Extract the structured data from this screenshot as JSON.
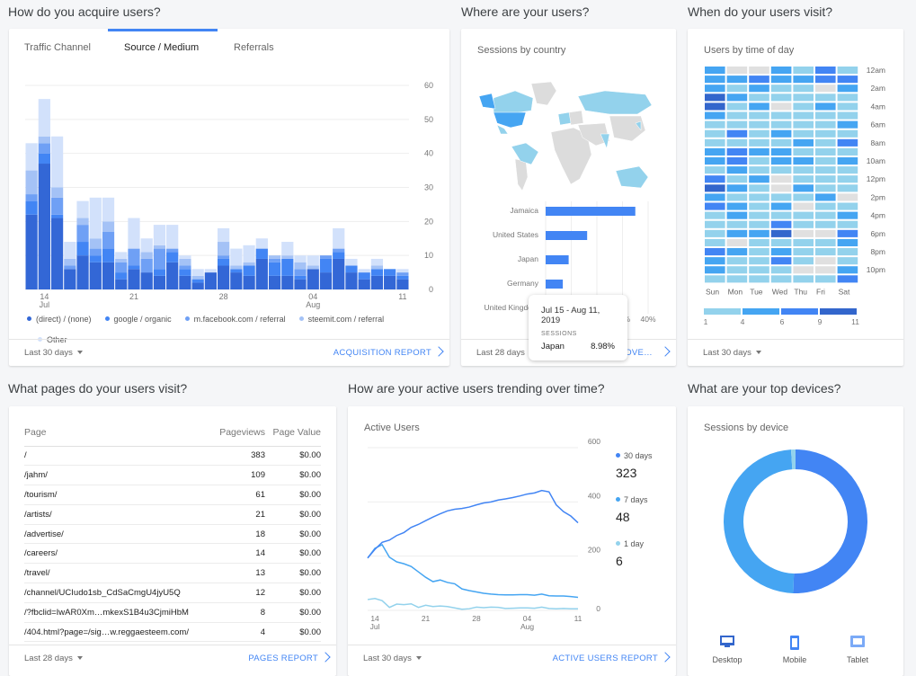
{
  "acquisition": {
    "section_title": "How do you acquire users?",
    "tabs": [
      {
        "label": "Traffic Channel",
        "active": false
      },
      {
        "label": "Source / Medium",
        "active": true
      },
      {
        "label": "Referrals",
        "active": false
      }
    ],
    "date_range": "Last 30 days",
    "report_link": "ACQUISITION REPORT"
  },
  "location": {
    "section_title": "Where are your users?",
    "card_title": "Sessions by country",
    "date_range": "Last 28 days",
    "report_link": "LOCATION OVERVIEW",
    "tooltip": {
      "date": "Jul 15 - Aug 11, 2019",
      "metric": "SESSIONS",
      "country": "Japan",
      "value": "8.98%"
    }
  },
  "time_of_day": {
    "section_title": "When do your users visit?",
    "card_title": "Users by time of day",
    "date_range": "Last 30 days"
  },
  "pages": {
    "section_title": "What pages do your users visit?",
    "columns": [
      "Page",
      "Pageviews",
      "Page Value"
    ],
    "rows": [
      [
        "/",
        "383",
        "$0.00"
      ],
      [
        "/jahm/",
        "109",
        "$0.00"
      ],
      [
        "/tourism/",
        "61",
        "$0.00"
      ],
      [
        "/artists/",
        "21",
        "$0.00"
      ],
      [
        "/advertise/",
        "18",
        "$0.00"
      ],
      [
        "/careers/",
        "14",
        "$0.00"
      ],
      [
        "/travel/",
        "13",
        "$0.00"
      ],
      [
        "/channel/UCIudo1sb_CdSaCmgU4jyU5Q",
        "12",
        "$0.00"
      ],
      [
        "/?fbclid=IwAR0Xm…mkexS1B4u3CjmiHbM",
        "8",
        "$0.00"
      ],
      [
        "/404.html?page=/sig…w.reggaesteem.com/",
        "4",
        "$0.00"
      ]
    ],
    "date_range": "Last 28 days",
    "report_link": "PAGES REPORT"
  },
  "active_users": {
    "section_title": "How are your active users trending over time?",
    "card_title": "Active Users",
    "legend": [
      {
        "label": "30 days",
        "value": "323",
        "color": "#4285f4"
      },
      {
        "label": "7 days",
        "value": "48",
        "color": "#45a5f2"
      },
      {
        "label": "1 day",
        "value": "6",
        "color": "#93d2ec"
      }
    ],
    "date_range": "Last 30 days",
    "report_link": "ACTIVE USERS REPORT"
  },
  "devices": {
    "section_title": "What are your top devices?",
    "card_title": "Sessions by device",
    "legend": [
      {
        "label": "Desktop",
        "icon": "desktop-icon",
        "color": "#3366cc"
      },
      {
        "label": "Mobile",
        "icon": "mobile-icon",
        "color": "#4285f4"
      },
      {
        "label": "Tablet",
        "icon": "tablet-icon",
        "color": "#7baaf7"
      }
    ]
  },
  "chart_data": [
    {
      "type": "bar",
      "stacked": true,
      "x_ticks": [
        {
          "label": "14",
          "sub": "Jul",
          "index": 1
        },
        {
          "label": "21",
          "index": 8
        },
        {
          "label": "28",
          "index": 15
        },
        {
          "label": "04",
          "sub": "Aug",
          "index": 22
        },
        {
          "label": "11",
          "index": 29
        }
      ],
      "categories": [
        "Jul 13",
        "Jul 14",
        "Jul 15",
        "Jul 16",
        "Jul 17",
        "Jul 18",
        "Jul 19",
        "Jul 20",
        "Jul 21",
        "Jul 22",
        "Jul 23",
        "Jul 24",
        "Jul 25",
        "Jul 26",
        "Jul 27",
        "Jul 28",
        "Jul 29",
        "Jul 30",
        "Jul 31",
        "Aug 1",
        "Aug 2",
        "Aug 3",
        "Aug 4",
        "Aug 5",
        "Aug 6",
        "Aug 7",
        "Aug 8",
        "Aug 9",
        "Aug 10",
        "Aug 11"
      ],
      "ylim": [
        0,
        60
      ],
      "yticks": [
        0,
        10,
        20,
        30,
        40,
        50,
        60
      ],
      "grid": true,
      "legend": "bottom",
      "series": [
        {
          "name": "(direct) / (none)",
          "color": "#3367d6",
          "values": [
            22,
            37,
            21,
            6,
            10,
            8,
            8,
            3,
            6,
            5,
            4,
            8,
            4,
            2,
            5,
            7,
            5,
            4,
            9,
            4,
            4,
            3,
            6,
            5,
            9,
            5,
            3,
            4,
            4,
            3
          ]
        },
        {
          "name": "google / organic",
          "color": "#4285f4",
          "values": [
            4,
            3,
            1,
            0,
            4,
            2,
            4,
            2,
            1,
            0,
            2,
            3,
            2,
            1,
            0,
            2,
            1,
            3,
            3,
            4,
            5,
            1,
            0,
            4,
            2,
            2,
            2,
            2,
            2,
            1
          ]
        },
        {
          "name": "m.facebook.com / referral",
          "color": "#6fa0f5",
          "values": [
            2,
            3,
            5,
            1,
            5,
            2,
            5,
            3,
            5,
            4,
            6,
            1,
            1,
            0,
            0,
            1,
            0,
            0,
            0,
            1,
            0,
            2,
            0,
            1,
            1,
            0,
            0,
            0,
            0,
            1
          ]
        },
        {
          "name": "steemit.com / referral",
          "color": "#a4c2f6",
          "values": [
            7,
            2,
            3,
            2,
            2,
            3,
            3,
            1,
            0,
            2,
            1,
            0,
            2,
            1,
            0,
            4,
            1,
            1,
            0,
            1,
            1,
            2,
            1,
            0,
            0,
            0,
            0,
            1,
            0,
            0
          ]
        },
        {
          "name": "Other",
          "color": "#d2e1fb",
          "values": [
            8,
            11,
            15,
            5,
            5,
            12,
            7,
            2,
            9,
            4,
            6,
            7,
            1,
            2,
            1,
            4,
            5,
            5,
            3,
            0,
            4,
            2,
            3,
            0,
            6,
            2,
            1,
            2,
            0,
            1
          ]
        }
      ]
    },
    {
      "type": "bar",
      "orientation": "horizontal",
      "categories": [
        "Jamaica",
        "United States",
        "Japan",
        "Germany",
        "United Kingdom"
      ],
      "values": [
        35,
        16.2,
        8.98,
        6.7,
        null
      ],
      "xlim": [
        0,
        40
      ],
      "xticks": [
        "0%",
        "10%",
        "20%",
        "30%",
        "40%"
      ],
      "color": "#4285f4"
    },
    {
      "type": "heatmap",
      "rows": [
        "12am",
        "1am",
        "2am",
        "3am",
        "4am",
        "5am",
        "6am",
        "7am",
        "8am",
        "9am",
        "10am",
        "11am",
        "12pm",
        "1pm",
        "2pm",
        "3pm",
        "4pm",
        "5pm",
        "6pm",
        "7pm",
        "8pm",
        "9pm",
        "10pm",
        "11pm"
      ],
      "row_labels": [
        "12am",
        "2am",
        "4am",
        "6am",
        "8am",
        "10am",
        "12pm",
        "2pm",
        "4pm",
        "6pm",
        "8pm",
        "10pm"
      ],
      "columns": [
        "Sun",
        "Mon",
        "Tue",
        "Wed",
        "Thu",
        "Fri",
        "Sat"
      ],
      "scale_labels": [
        "1",
        "4",
        "6",
        "9",
        "11"
      ],
      "colors": [
        "#e0e0e0",
        "#93d2ec",
        "#45a5f2",
        "#4285f4",
        "#3366cc"
      ],
      "levels": [
        [
          2,
          0,
          0,
          2,
          1,
          3,
          1
        ],
        [
          2,
          2,
          3,
          2,
          2,
          3,
          3
        ],
        [
          2,
          1,
          2,
          1,
          1,
          0,
          2
        ],
        [
          4,
          2,
          1,
          1,
          1,
          1,
          1
        ],
        [
          4,
          1,
          2,
          0,
          1,
          2,
          1
        ],
        [
          2,
          1,
          1,
          1,
          1,
          1,
          1
        ],
        [
          1,
          1,
          1,
          1,
          1,
          1,
          2
        ],
        [
          1,
          3,
          1,
          2,
          1,
          1,
          1
        ],
        [
          1,
          1,
          1,
          1,
          2,
          1,
          3
        ],
        [
          2,
          3,
          2,
          2,
          1,
          1,
          1
        ],
        [
          2,
          3,
          1,
          2,
          2,
          1,
          2
        ],
        [
          1,
          2,
          1,
          1,
          1,
          1,
          1
        ],
        [
          3,
          1,
          2,
          0,
          1,
          1,
          1
        ],
        [
          4,
          2,
          1,
          0,
          2,
          1,
          1
        ],
        [
          2,
          1,
          1,
          1,
          1,
          2,
          0
        ],
        [
          3,
          2,
          1,
          2,
          0,
          1,
          1
        ],
        [
          1,
          2,
          1,
          1,
          1,
          1,
          2
        ],
        [
          1,
          1,
          1,
          3,
          1,
          1,
          1
        ],
        [
          1,
          2,
          2,
          4,
          0,
          0,
          3
        ],
        [
          1,
          0,
          1,
          1,
          1,
          1,
          2
        ],
        [
          3,
          2,
          1,
          2,
          1,
          1,
          1
        ],
        [
          2,
          1,
          1,
          3,
          1,
          0,
          1
        ],
        [
          2,
          1,
          1,
          1,
          0,
          0,
          2
        ],
        [
          1,
          1,
          1,
          1,
          1,
          1,
          3
        ]
      ]
    },
    {
      "type": "line",
      "ylim": [
        0,
        600
      ],
      "yticks": [
        0,
        200,
        400,
        600
      ],
      "grid": true,
      "legend": "right",
      "x_ticks": [
        {
          "label": "14",
          "sub": "Jul",
          "index": 1
        },
        {
          "label": "21",
          "index": 8
        },
        {
          "label": "28",
          "index": 15
        },
        {
          "label": "04",
          "sub": "Aug",
          "index": 22
        },
        {
          "label": "11",
          "index": 29
        }
      ],
      "series": [
        {
          "name": "30 days",
          "color": "#4285f4",
          "values": [
            193,
            225,
            251,
            259,
            276,
            287,
            306,
            317,
            331,
            344,
            356,
            367,
            373,
            376,
            381,
            389,
            396,
            400,
            407,
            411,
            416,
            422,
            429,
            433,
            442,
            437,
            389,
            364,
            348,
            323
          ]
        },
        {
          "name": "7 days",
          "color": "#45a5f2",
          "values": [
            193,
            229,
            242,
            196,
            179,
            172,
            162,
            142,
            122,
            106,
            112,
            103,
            98,
            79,
            73,
            68,
            63,
            60,
            58,
            57,
            57,
            58,
            58,
            56,
            60,
            54,
            53,
            53,
            51,
            48
          ]
        },
        {
          "name": "1 day",
          "color": "#93d2ec",
          "values": [
            40,
            44,
            36,
            11,
            23,
            21,
            24,
            11,
            19,
            14,
            16,
            14,
            9,
            4,
            6,
            12,
            10,
            12,
            11,
            7,
            8,
            9,
            9,
            8,
            12,
            7,
            6,
            7,
            6,
            6
          ]
        }
      ]
    },
    {
      "type": "pie",
      "donut": true,
      "categories": [
        "Desktop",
        "Mobile",
        "Tablet"
      ],
      "values": [
        50.5,
        48.5,
        1.0
      ],
      "colors": [
        "#4285f4",
        "#45a5f2",
        "#93d2ec"
      ]
    }
  ]
}
